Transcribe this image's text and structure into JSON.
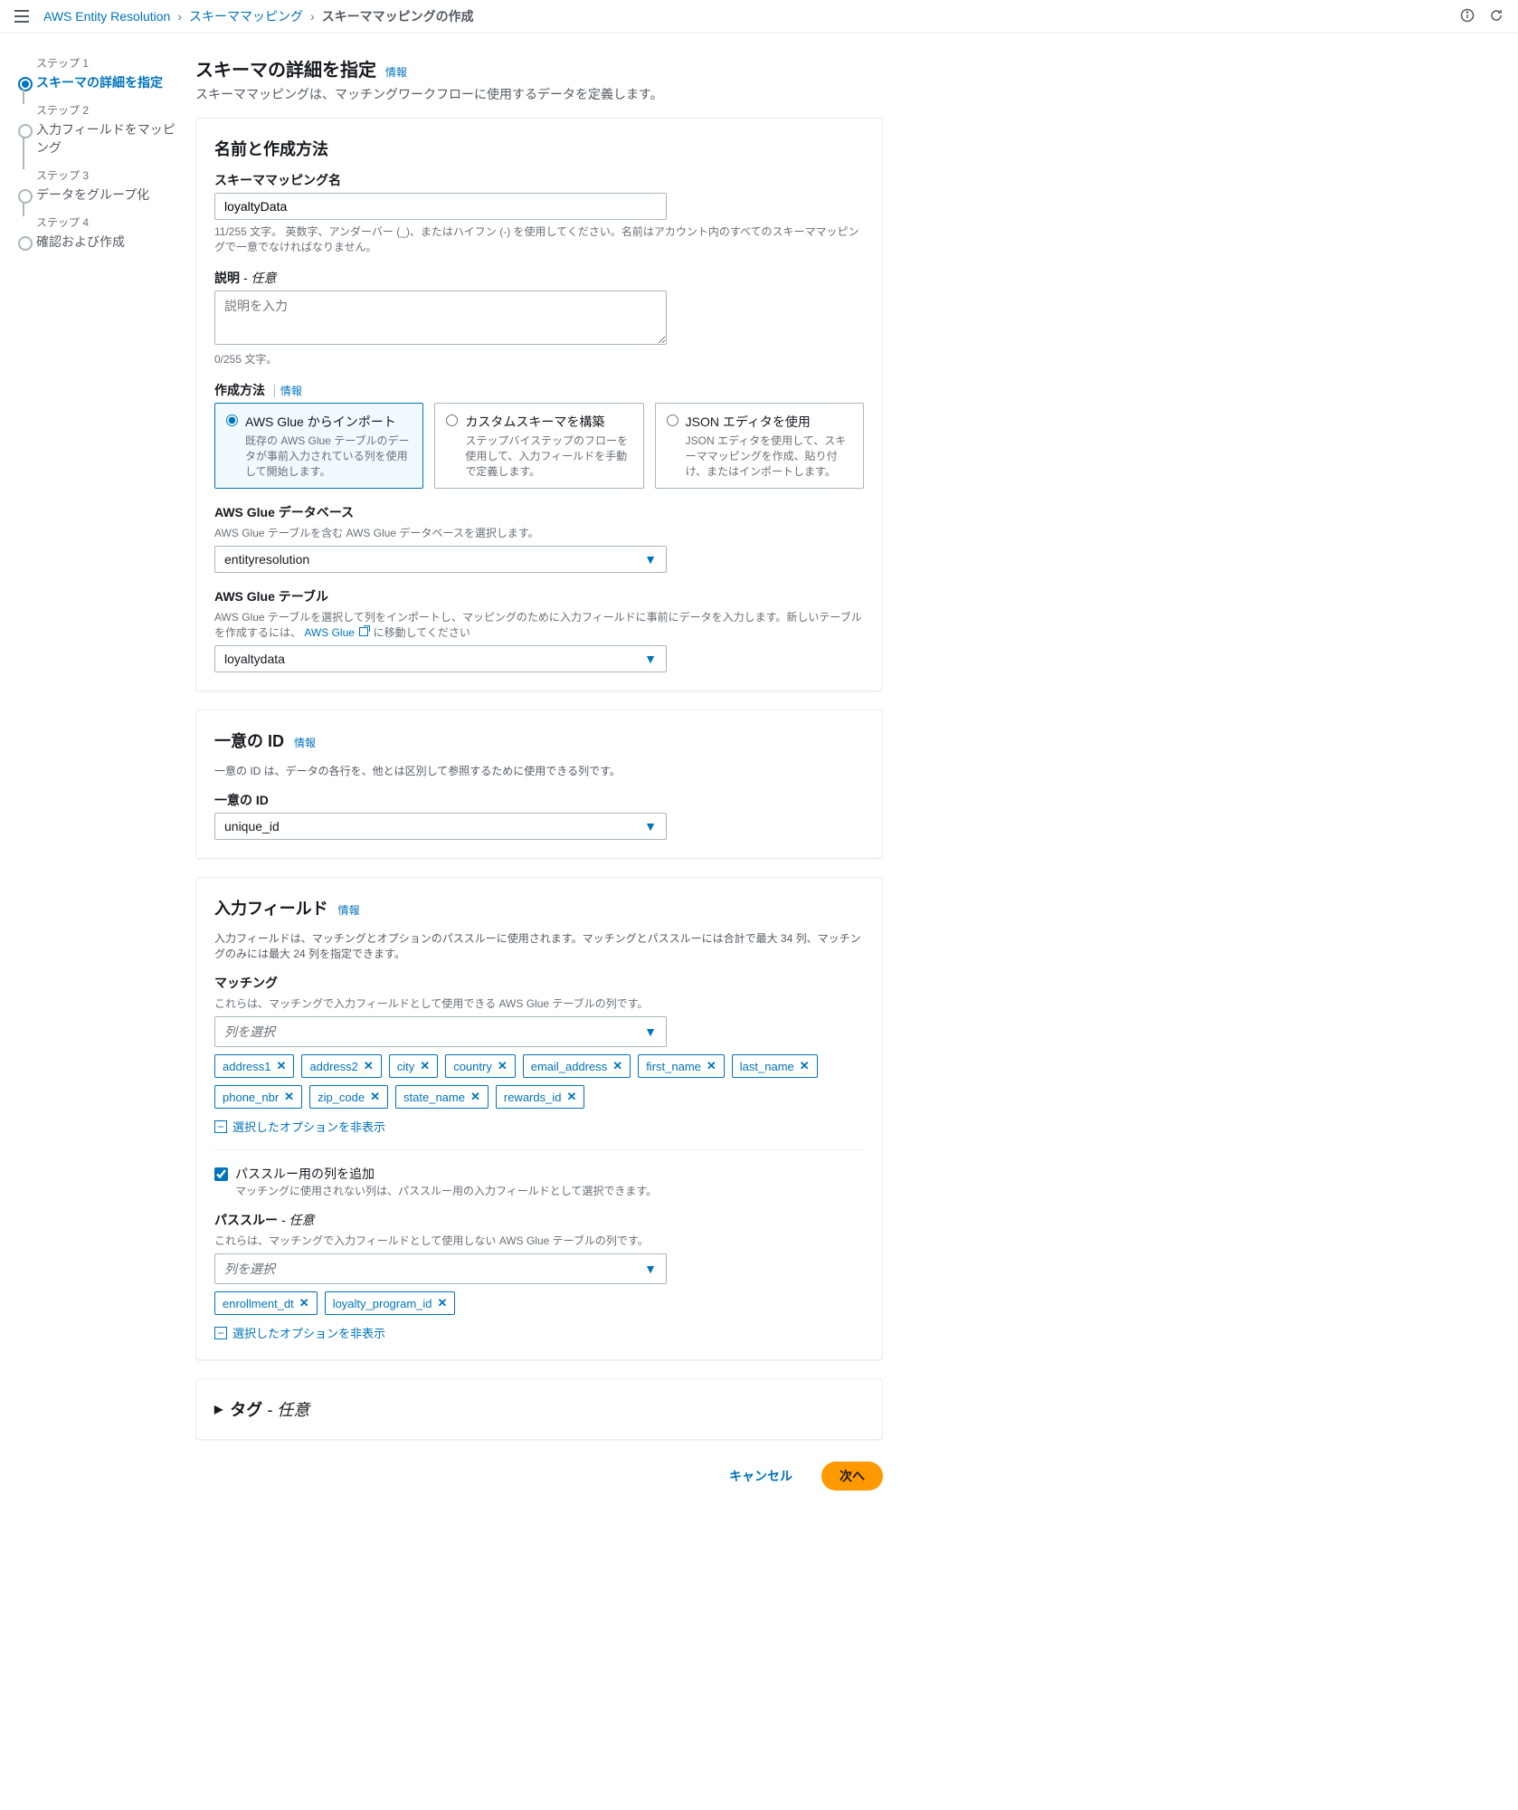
{
  "breadcrumb": {
    "root": "AWS Entity Resolution",
    "parent": "スキーママッピング",
    "current": "スキーママッピングの作成"
  },
  "steps": [
    {
      "num": "ステップ 1",
      "title": "スキーマの詳細を指定"
    },
    {
      "num": "ステップ 2",
      "title": "入力フィールドをマッピング"
    },
    {
      "num": "ステップ 3",
      "title": "データをグループ化"
    },
    {
      "num": "ステップ 4",
      "title": "確認および作成"
    }
  ],
  "header": {
    "title": "スキーマの詳細を指定",
    "info": "情報",
    "desc": "スキーママッピングは、マッチングワークフローに使用するデータを定義します。"
  },
  "name_section": {
    "title": "名前と作成方法",
    "name_label": "スキーママッピング名",
    "name_value": "loyaltyData",
    "name_hint": "11/255 文字。 英数字、アンダーバー (_)、またはハイフン (-) を使用してください。名前はアカウント内のすべてのスキーママッピングで一意でなければなりません。",
    "desc_label": "説明",
    "desc_optional": " - 任意",
    "desc_placeholder": "説明を入力",
    "desc_hint": "0/255 文字。",
    "method_label": "作成方法",
    "method_info": "情報",
    "methods": [
      {
        "title": "AWS Glue からインポート",
        "desc": "既存の AWS Glue テーブルのデータが事前入力されている列を使用して開始します。"
      },
      {
        "title": "カスタムスキーマを構築",
        "desc": "ステップバイステップのフローを使用して、入力フィールドを手動で定義します。"
      },
      {
        "title": "JSON エディタを使用",
        "desc": "JSON エディタを使用して、スキーママッピングを作成、貼り付け、またはインポートします。"
      }
    ],
    "db_label": "AWS Glue データベース",
    "db_desc": "AWS Glue テーブルを含む AWS Glue データベースを選択します。",
    "db_value": "entityresolution",
    "table_label": "AWS Glue テーブル",
    "table_desc_pre": "AWS Glue テーブルを選択して列をインポートし、マッピングのために入力フィールドに事前にデータを入力します。新しいテーブルを作成するには、",
    "table_link": "AWS Glue",
    "table_desc_post": "に移動してください",
    "table_value": "loyaltydata"
  },
  "unique_section": {
    "title": "一意の ID",
    "info": "情報",
    "desc": "一意の ID は、データの各行を、他とは区別して参照するために使用できる列です。",
    "label": "一意の ID",
    "value": "unique_id"
  },
  "input_section": {
    "title": "入力フィールド",
    "info": "情報",
    "desc": "入力フィールドは、マッチングとオプションのパススルーに使用されます。マッチングとパススルーには合計で最大 34 列、マッチングのみには最大 24 列を指定できます。",
    "matching_label": "マッチング",
    "matching_desc": "これらは、マッチングで入力フィールドとして使用できる AWS Glue テーブルの列です。",
    "select_placeholder": "列を選択",
    "matching_chips": [
      "address1",
      "address2",
      "city",
      "country",
      "email_address",
      "first_name",
      "last_name",
      "phone_nbr",
      "zip_code",
      "state_name",
      "rewards_id"
    ],
    "hide_options": "選択したオプションを非表示",
    "passthrough_cb_label": "パススルー用の列を追加",
    "passthrough_cb_desc": "マッチングに使用されない列は、パススルー用の入力フィールドとして選択できます。",
    "passthrough_label": "パススルー",
    "passthrough_optional": " - 任意",
    "passthrough_desc": "これらは、マッチングで入力フィールドとして使用しない AWS Glue テーブルの列です。",
    "passthrough_chips": [
      "enrollment_dt",
      "loyalty_program_id"
    ]
  },
  "tags": {
    "title": "タグ",
    "optional": " - 任意"
  },
  "footer": {
    "cancel": "キャンセル",
    "next": "次へ"
  }
}
